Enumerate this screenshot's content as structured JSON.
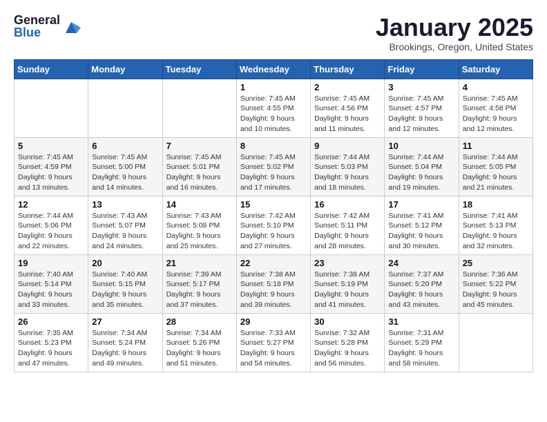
{
  "logo": {
    "general": "General",
    "blue": "Blue"
  },
  "header": {
    "month": "January 2025",
    "location": "Brookings, Oregon, United States"
  },
  "weekdays": [
    "Sunday",
    "Monday",
    "Tuesday",
    "Wednesday",
    "Thursday",
    "Friday",
    "Saturday"
  ],
  "weeks": [
    [
      {
        "day": "",
        "sunrise": "",
        "sunset": "",
        "daylight": ""
      },
      {
        "day": "",
        "sunrise": "",
        "sunset": "",
        "daylight": ""
      },
      {
        "day": "",
        "sunrise": "",
        "sunset": "",
        "daylight": ""
      },
      {
        "day": "1",
        "sunrise": "Sunrise: 7:45 AM",
        "sunset": "Sunset: 4:55 PM",
        "daylight": "Daylight: 9 hours and 10 minutes."
      },
      {
        "day": "2",
        "sunrise": "Sunrise: 7:45 AM",
        "sunset": "Sunset: 4:56 PM",
        "daylight": "Daylight: 9 hours and 11 minutes."
      },
      {
        "day": "3",
        "sunrise": "Sunrise: 7:45 AM",
        "sunset": "Sunset: 4:57 PM",
        "daylight": "Daylight: 9 hours and 12 minutes."
      },
      {
        "day": "4",
        "sunrise": "Sunrise: 7:45 AM",
        "sunset": "Sunset: 4:58 PM",
        "daylight": "Daylight: 9 hours and 12 minutes."
      }
    ],
    [
      {
        "day": "5",
        "sunrise": "Sunrise: 7:45 AM",
        "sunset": "Sunset: 4:59 PM",
        "daylight": "Daylight: 9 hours and 13 minutes."
      },
      {
        "day": "6",
        "sunrise": "Sunrise: 7:45 AM",
        "sunset": "Sunset: 5:00 PM",
        "daylight": "Daylight: 9 hours and 14 minutes."
      },
      {
        "day": "7",
        "sunrise": "Sunrise: 7:45 AM",
        "sunset": "Sunset: 5:01 PM",
        "daylight": "Daylight: 9 hours and 16 minutes."
      },
      {
        "day": "8",
        "sunrise": "Sunrise: 7:45 AM",
        "sunset": "Sunset: 5:02 PM",
        "daylight": "Daylight: 9 hours and 17 minutes."
      },
      {
        "day": "9",
        "sunrise": "Sunrise: 7:44 AM",
        "sunset": "Sunset: 5:03 PM",
        "daylight": "Daylight: 9 hours and 18 minutes."
      },
      {
        "day": "10",
        "sunrise": "Sunrise: 7:44 AM",
        "sunset": "Sunset: 5:04 PM",
        "daylight": "Daylight: 9 hours and 19 minutes."
      },
      {
        "day": "11",
        "sunrise": "Sunrise: 7:44 AM",
        "sunset": "Sunset: 5:05 PM",
        "daylight": "Daylight: 9 hours and 21 minutes."
      }
    ],
    [
      {
        "day": "12",
        "sunrise": "Sunrise: 7:44 AM",
        "sunset": "Sunset: 5:06 PM",
        "daylight": "Daylight: 9 hours and 22 minutes."
      },
      {
        "day": "13",
        "sunrise": "Sunrise: 7:43 AM",
        "sunset": "Sunset: 5:07 PM",
        "daylight": "Daylight: 9 hours and 24 minutes."
      },
      {
        "day": "14",
        "sunrise": "Sunrise: 7:43 AM",
        "sunset": "Sunset: 5:08 PM",
        "daylight": "Daylight: 9 hours and 25 minutes."
      },
      {
        "day": "15",
        "sunrise": "Sunrise: 7:42 AM",
        "sunset": "Sunset: 5:10 PM",
        "daylight": "Daylight: 9 hours and 27 minutes."
      },
      {
        "day": "16",
        "sunrise": "Sunrise: 7:42 AM",
        "sunset": "Sunset: 5:11 PM",
        "daylight": "Daylight: 9 hours and 28 minutes."
      },
      {
        "day": "17",
        "sunrise": "Sunrise: 7:41 AM",
        "sunset": "Sunset: 5:12 PM",
        "daylight": "Daylight: 9 hours and 30 minutes."
      },
      {
        "day": "18",
        "sunrise": "Sunrise: 7:41 AM",
        "sunset": "Sunset: 5:13 PM",
        "daylight": "Daylight: 9 hours and 32 minutes."
      }
    ],
    [
      {
        "day": "19",
        "sunrise": "Sunrise: 7:40 AM",
        "sunset": "Sunset: 5:14 PM",
        "daylight": "Daylight: 9 hours and 33 minutes."
      },
      {
        "day": "20",
        "sunrise": "Sunrise: 7:40 AM",
        "sunset": "Sunset: 5:15 PM",
        "daylight": "Daylight: 9 hours and 35 minutes."
      },
      {
        "day": "21",
        "sunrise": "Sunrise: 7:39 AM",
        "sunset": "Sunset: 5:17 PM",
        "daylight": "Daylight: 9 hours and 37 minutes."
      },
      {
        "day": "22",
        "sunrise": "Sunrise: 7:38 AM",
        "sunset": "Sunset: 5:18 PM",
        "daylight": "Daylight: 9 hours and 39 minutes."
      },
      {
        "day": "23",
        "sunrise": "Sunrise: 7:38 AM",
        "sunset": "Sunset: 5:19 PM",
        "daylight": "Daylight: 9 hours and 41 minutes."
      },
      {
        "day": "24",
        "sunrise": "Sunrise: 7:37 AM",
        "sunset": "Sunset: 5:20 PM",
        "daylight": "Daylight: 9 hours and 43 minutes."
      },
      {
        "day": "25",
        "sunrise": "Sunrise: 7:36 AM",
        "sunset": "Sunset: 5:22 PM",
        "daylight": "Daylight: 9 hours and 45 minutes."
      }
    ],
    [
      {
        "day": "26",
        "sunrise": "Sunrise: 7:35 AM",
        "sunset": "Sunset: 5:23 PM",
        "daylight": "Daylight: 9 hours and 47 minutes."
      },
      {
        "day": "27",
        "sunrise": "Sunrise: 7:34 AM",
        "sunset": "Sunset: 5:24 PM",
        "daylight": "Daylight: 9 hours and 49 minutes."
      },
      {
        "day": "28",
        "sunrise": "Sunrise: 7:34 AM",
        "sunset": "Sunset: 5:26 PM",
        "daylight": "Daylight: 9 hours and 51 minutes."
      },
      {
        "day": "29",
        "sunrise": "Sunrise: 7:33 AM",
        "sunset": "Sunset: 5:27 PM",
        "daylight": "Daylight: 9 hours and 54 minutes."
      },
      {
        "day": "30",
        "sunrise": "Sunrise: 7:32 AM",
        "sunset": "Sunset: 5:28 PM",
        "daylight": "Daylight: 9 hours and 56 minutes."
      },
      {
        "day": "31",
        "sunrise": "Sunrise: 7:31 AM",
        "sunset": "Sunset: 5:29 PM",
        "daylight": "Daylight: 9 hours and 58 minutes."
      },
      {
        "day": "",
        "sunrise": "",
        "sunset": "",
        "daylight": ""
      }
    ]
  ]
}
